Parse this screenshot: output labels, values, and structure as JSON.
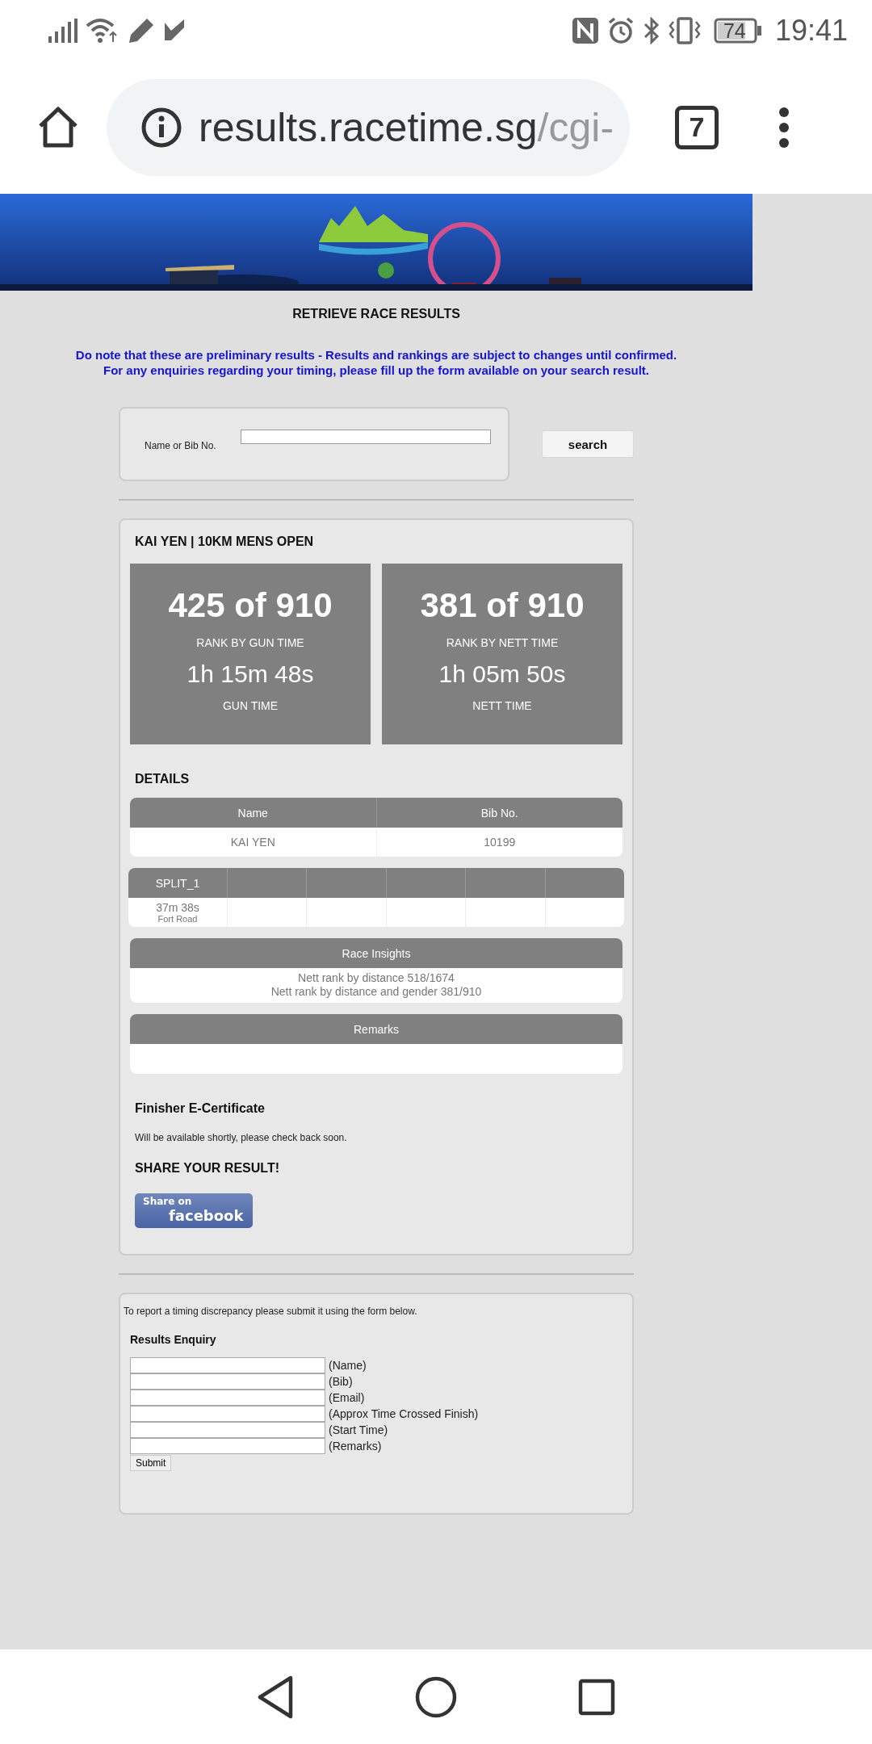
{
  "status_bar": {
    "battery": "74",
    "time": "19:41"
  },
  "browser": {
    "url_host": "results.racetime.sg",
    "url_path": "/cgi-",
    "tab_count": "7"
  },
  "page": {
    "heading": "RETRIEVE RACE RESULTS",
    "notices": [
      "Do note that these are preliminary results - Results and rankings are subject to changes until confirmed.",
      "For any enquiries regarding your timing, please fill up the form available on your search result."
    ],
    "search": {
      "label": "Name or Bib No.",
      "button": "search"
    }
  },
  "result": {
    "title": "KAI YEN | 10KM MENS OPEN",
    "ranks": [
      {
        "rank": "425 of 910",
        "rank_label": "RANK BY GUN TIME",
        "time": "1h 15m 48s",
        "time_label": "GUN TIME"
      },
      {
        "rank": "381 of 910",
        "rank_label": "RANK BY NETT TIME",
        "time": "1h 05m 50s",
        "time_label": "NETT TIME"
      }
    ],
    "details_heading": "DETAILS",
    "details_table": {
      "columns": [
        "Name",
        "Bib No."
      ],
      "row": [
        "KAI YEN",
        "10199"
      ]
    },
    "split": {
      "label": "SPLIT_1",
      "time": "37m 38s",
      "location": "Fort Road"
    },
    "insights": {
      "title": "Race Insights",
      "lines": [
        "Nett rank by distance 518/1674",
        "Nett rank by distance and gender 381/910"
      ]
    },
    "remarks": {
      "title": "Remarks"
    },
    "certificate": {
      "heading": "Finisher E-Certificate",
      "text": "Will be available shortly, please check back soon."
    },
    "share": {
      "heading": "SHARE YOUR RESULT!",
      "button_lines": [
        "Share on",
        "facebook"
      ]
    }
  },
  "enquiry": {
    "intro": "To report a timing discrepancy please submit it using the form below.",
    "heading": "Results Enquiry",
    "fields": [
      {
        "label": "(Name)"
      },
      {
        "label": "(Bib)"
      },
      {
        "label": "(Email)"
      },
      {
        "label": "(Approx Time Crossed Finish)"
      },
      {
        "label": "(Start Time)"
      },
      {
        "label": "(Remarks)"
      }
    ],
    "submit": "Submit"
  }
}
